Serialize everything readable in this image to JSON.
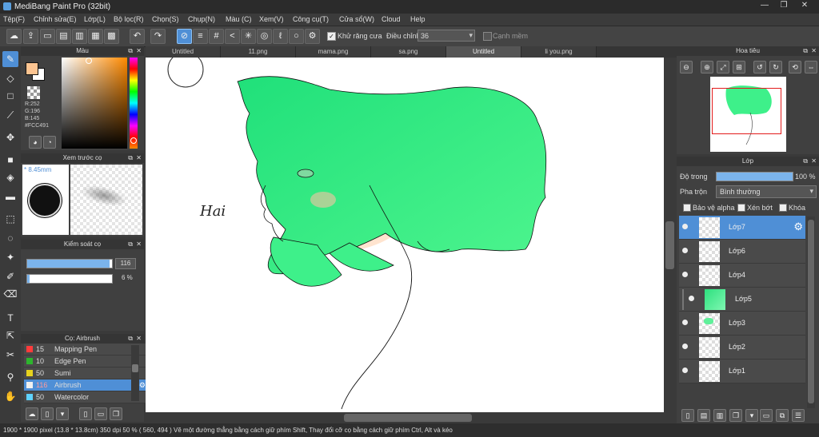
{
  "window": {
    "title": "MediBang Paint Pro (32bit)"
  },
  "menu": [
    "Tệp(F)",
    "Chỉnh sửa(E)",
    "Lớp(L)",
    "Bộ lọc(R)",
    "Chọn(S)",
    "Chụp(N)",
    "Màu (C)",
    "Xem(V)",
    "Công cụ(T)",
    "Cửa sổ(W)",
    "Cloud",
    "Help"
  ],
  "toolbar": {
    "antialias_label": "Khử răng cưa",
    "antialias_checked": "✓",
    "adjust_label": "Điều chỉnh",
    "adjust_value": "36",
    "edge_label": "Cạnh mềm",
    "undo_icon": "↶",
    "redo_icon": "↷"
  },
  "color_panel": {
    "title": "Màu",
    "r": "R:252",
    "g": "G:196",
    "b": "B:145",
    "hex": "#FCC491",
    "fg_color": "#fcc491",
    "bg_color": "#ffffff"
  },
  "brush_preview": {
    "title": "Xem trước cọ",
    "size_label": "* 8.45mm"
  },
  "brush_control": {
    "title": "Kiểm soát cọ",
    "size_value": "116",
    "opacity_value": "6 %",
    "size_level": 0.97,
    "opacity_level": 0.03
  },
  "brush_list": {
    "title": "Cọ: Airbrush",
    "items": [
      {
        "size": "15",
        "name": "Mapping Pen",
        "color": "#ff3b3b"
      },
      {
        "size": "10",
        "name": "Edge Pen",
        "color": "#2db52d"
      },
      {
        "size": "50",
        "name": "Sumi",
        "color": "#e6d21e"
      },
      {
        "size": "116",
        "name": "Airbrush",
        "color": "#f0f0f0"
      },
      {
        "size": "50",
        "name": "Watercolor",
        "color": "#5fd2ff"
      }
    ]
  },
  "tabs": [
    "Untitled",
    "11.png",
    "mama.png",
    "sa.png",
    "Untitled",
    "li you.png"
  ],
  "canvas": {
    "signature": "Hai"
  },
  "navigator": {
    "title": "Hoa tiêu"
  },
  "layers_panel": {
    "title": "Lớp",
    "opacity_label": "Độ trong",
    "opacity_value": "100 %",
    "opacity_level": 1.0,
    "blend_label": "Pha trộn",
    "blend_value": "Bình thường",
    "protect_alpha": "Bảo vệ alpha",
    "clipping": "Xén bớt",
    "lock": "Khóa",
    "layers": [
      "Lớp7",
      "Lớp6",
      "Lớp4",
      "Lớp5",
      "Lớp3",
      "Lớp2",
      "Lớp1"
    ]
  },
  "status": {
    "text": "1900 * 1900 pixel   (13.8 * 13.8cm)   350 dpi   50 %   ( 560, 494 )   Vẽ một đường thẳng bằng cách giữ phím Shift, Thay đổi cỡ cọ bằng cách giữ phím Ctrl, Alt và kéo"
  }
}
